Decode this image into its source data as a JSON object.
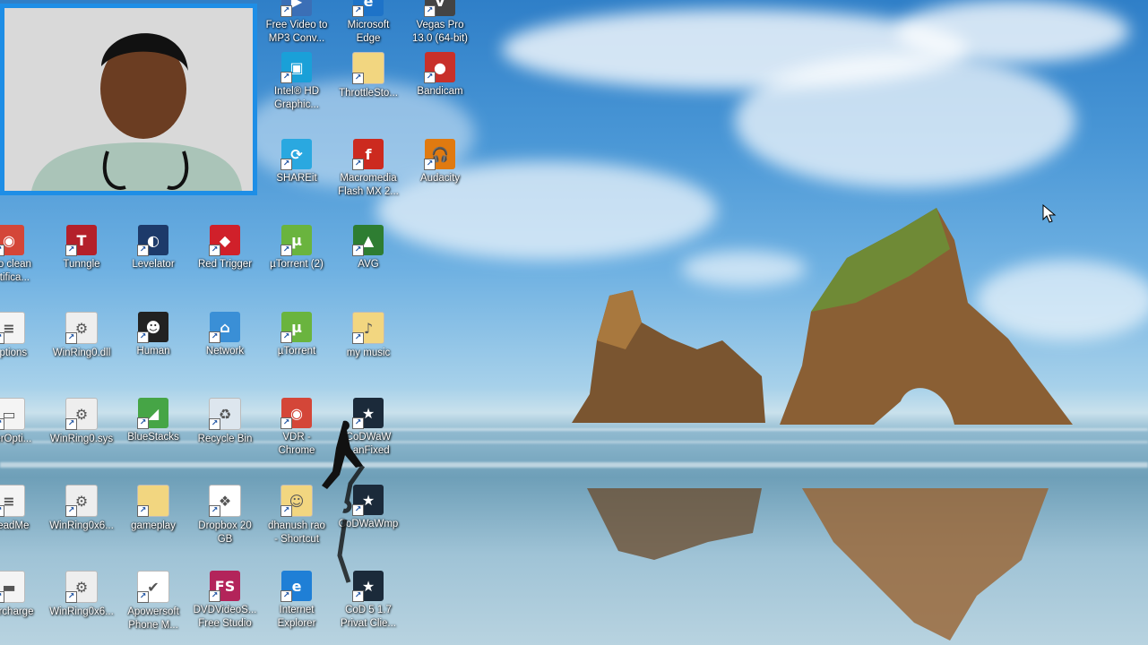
{
  "wallpaper": {
    "description": "Windows 10 beach wallpaper with rock arches"
  },
  "desktop_icons": [
    {
      "label": "Free Video to\nMP3 Conv...",
      "icon": "video-converter-icon",
      "color": "#3b6fb6"
    },
    {
      "label": "Microsoft\nEdge",
      "icon": "edge-icon",
      "color": "#1e73c8"
    },
    {
      "label": "Vegas Pro\n13.0 (64-bit)",
      "icon": "vegas-icon",
      "color": "#444444"
    },
    {
      "label": "Intel® HD\nGraphic...",
      "icon": "intel-graphics-icon",
      "color": "#1aa0d8"
    },
    {
      "label": "ThrottleSto...",
      "icon": "folder-icon",
      "color": "#f2d680"
    },
    {
      "label": "Bandicam",
      "icon": "bandicam-icon",
      "color": "#c8302a"
    },
    {
      "label": "SHAREit",
      "icon": "shareit-icon",
      "color": "#2aa8e0"
    },
    {
      "label": "Macromedia\nFlash MX 2...",
      "icon": "flash-icon",
      "color": "#cc2a1f"
    },
    {
      "label": "Audacity",
      "icon": "audacity-icon",
      "color": "#e07a10"
    },
    {
      "label": "...to clean\nnotifica...",
      "icon": "chrome-icon",
      "color": "#d44638"
    },
    {
      "label": "Tunngle",
      "icon": "tunngle-icon",
      "color": "#b4202a"
    },
    {
      "label": "Levelator",
      "icon": "levelator-icon",
      "color": "#1d3a6a"
    },
    {
      "label": "Red Trigger",
      "icon": "red-trigger-icon",
      "color": "#d0202a"
    },
    {
      "label": "µTorrent (2)",
      "icon": "utorrent-icon",
      "color": "#6ab43e"
    },
    {
      "label": "AVG",
      "icon": "avg-icon",
      "color": "#2e7d32"
    },
    {
      "label": "...ptions",
      "icon": "document-icon",
      "color": "#f4f4f4"
    },
    {
      "label": "WinRing0.dll",
      "icon": "dll-file-icon",
      "color": "#eeeeee"
    },
    {
      "label": "Human",
      "icon": "human-icon",
      "color": "#222222"
    },
    {
      "label": "Network",
      "icon": "network-icon",
      "color": "#3a8fd6"
    },
    {
      "label": "µTorrent",
      "icon": "utorrent-icon",
      "color": "#6ab43e"
    },
    {
      "label": "my music",
      "icon": "music-folder-icon",
      "color": "#f2d680"
    },
    {
      "label": "...erOpti...",
      "icon": "window-icon",
      "color": "#f4f4f4"
    },
    {
      "label": "WinRing0.sys",
      "icon": "sys-file-icon",
      "color": "#eeeeee"
    },
    {
      "label": "BlueStacks",
      "icon": "bluestacks-icon",
      "color": "#46a546"
    },
    {
      "label": "Recycle Bin",
      "icon": "recycle-bin-icon",
      "color": "#dde6ee"
    },
    {
      "label": "VDR -\nChrome",
      "icon": "chrome-icon",
      "color": "#d44638"
    },
    {
      "label": "CoDWaW\nLanFixed",
      "icon": "cod-icon",
      "color": "#1b2a3a"
    },
    {
      "label": "...eadMe",
      "icon": "text-file-icon",
      "color": "#f4f4f4"
    },
    {
      "label": "WinRing0x6...",
      "icon": "file-icon",
      "color": "#eeeeee"
    },
    {
      "label": "gameplay",
      "icon": "folder-icon",
      "color": "#f2d680"
    },
    {
      "label": "Dropbox 20\nGB",
      "icon": "dropbox-icon",
      "color": "#ffffff"
    },
    {
      "label": "dhanush rao\n- Shortcut",
      "icon": "user-folder-icon",
      "color": "#f2d680"
    },
    {
      "label": "CoDWaWmp",
      "icon": "cod-icon",
      "color": "#1b2a3a"
    },
    {
      "label": "...ercharge",
      "icon": "keyboard-icon",
      "color": "#f4f4f4"
    },
    {
      "label": "WinRing0x6...",
      "icon": "file-icon",
      "color": "#eeeeee"
    },
    {
      "label": "Apowersoft\nPhone M...",
      "icon": "apowersoft-icon",
      "color": "#ffffff"
    },
    {
      "label": "DVDVideoS...\nFree Studio",
      "icon": "dvdvideosoft-icon",
      "color": "#b3245a"
    },
    {
      "label": "Internet\nExplorer",
      "icon": "internet-explorer-icon",
      "color": "#1f7fd6"
    },
    {
      "label": "CoD 5 1.7\nPrivat Clie...",
      "icon": "cod-icon",
      "color": "#1b2a3a"
    }
  ],
  "glyphs": {
    "video-converter-icon": "▶",
    "edge-icon": "e",
    "vegas-icon": "V",
    "intel-graphics-icon": "▣",
    "folder-icon": "",
    "bandicam-icon": "●",
    "shareit-icon": "⟳",
    "flash-icon": "f",
    "audacity-icon": "🎧",
    "chrome-icon": "◉",
    "tunngle-icon": "T",
    "levelator-icon": "◐",
    "red-trigger-icon": "◆",
    "utorrent-icon": "µ",
    "avg-icon": "▲",
    "document-icon": "≡",
    "dll-file-icon": "⚙",
    "human-icon": "☻",
    "network-icon": "⌂",
    "music-folder-icon": "♪",
    "window-icon": "▭",
    "sys-file-icon": "⚙",
    "bluestacks-icon": "◢",
    "recycle-bin-icon": "♻",
    "cod-icon": "★",
    "text-file-icon": "≡",
    "file-icon": "⚙",
    "dropbox-icon": "❖",
    "user-folder-icon": "☺",
    "keyboard-icon": "▬",
    "apowersoft-icon": "✔",
    "dvdvideosoft-icon": "FS",
    "internet-explorer-icon": "e"
  }
}
